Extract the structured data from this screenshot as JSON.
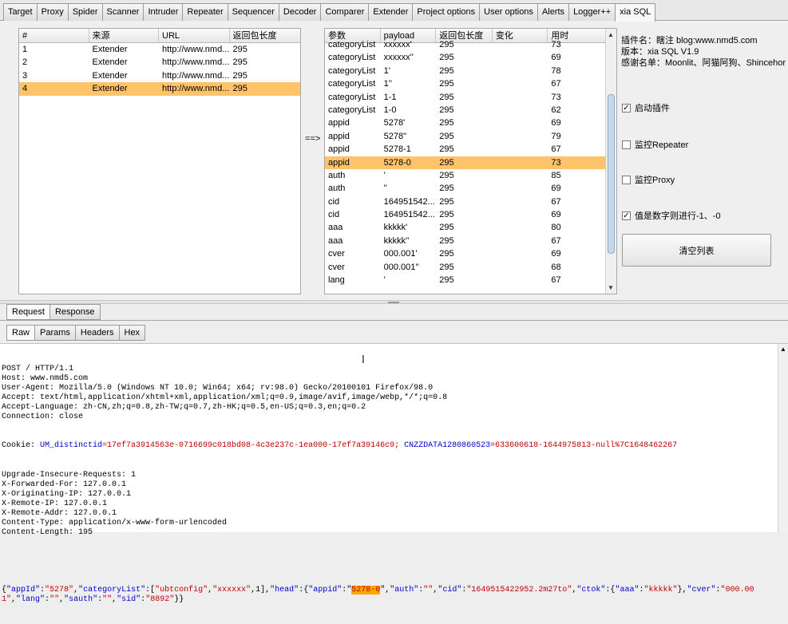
{
  "top_tabs": [
    "Target",
    "Proxy",
    "Spider",
    "Scanner",
    "Intruder",
    "Repeater",
    "Sequencer",
    "Decoder",
    "Comparer",
    "Extender",
    "Project options",
    "User options",
    "Alerts",
    "Logger++",
    "xia SQL"
  ],
  "active_tab": "xia SQL",
  "left_table": {
    "headers": [
      "#",
      "来源",
      "URL",
      "返回包长度"
    ],
    "rows": [
      [
        "1",
        "Extender",
        "http://www.nmd...",
        "295"
      ],
      [
        "2",
        "Extender",
        "http://www.nmd...",
        "295"
      ],
      [
        "3",
        "Extender",
        "http://www.nmd...",
        "295"
      ],
      [
        "4",
        "Extender",
        "http://www.nmd...",
        "295"
      ]
    ],
    "selected_index": 3
  },
  "arrow": "==>",
  "right_table": {
    "headers": [
      "参数",
      "payload",
      "返回包长度",
      "变化",
      "用时"
    ],
    "rows": [
      [
        "categoryList",
        "xxxxxx'",
        "295",
        "",
        "73"
      ],
      [
        "categoryList",
        "xxxxxx''",
        "295",
        "",
        "69"
      ],
      [
        "categoryList",
        "1'",
        "295",
        "",
        "78"
      ],
      [
        "categoryList",
        "1''",
        "295",
        "",
        "67"
      ],
      [
        "categoryList",
        "1-1",
        "295",
        "",
        "73"
      ],
      [
        "categoryList",
        "1-0",
        "295",
        "",
        "62"
      ],
      [
        "appid",
        "5278'",
        "295",
        "",
        "69"
      ],
      [
        "appid",
        "5278''",
        "295",
        "",
        "79"
      ],
      [
        "appid",
        "5278-1",
        "295",
        "",
        "67"
      ],
      [
        "appid",
        "5278-0",
        "295",
        "",
        "73"
      ],
      [
        "auth",
        "'",
        "295",
        "",
        "85"
      ],
      [
        "auth",
        "''",
        "295",
        "",
        "69"
      ],
      [
        "cid",
        "164951542...",
        "295",
        "",
        "67"
      ],
      [
        "cid",
        "164951542...",
        "295",
        "",
        "69"
      ],
      [
        "aaa",
        "kkkkk'",
        "295",
        "",
        "80"
      ],
      [
        "aaa",
        "kkkkk''",
        "295",
        "",
        "67"
      ],
      [
        "cver",
        "000.001'",
        "295",
        "",
        "69"
      ],
      [
        "cver",
        "000.001''",
        "295",
        "",
        "68"
      ],
      [
        "lang",
        "'",
        "295",
        "",
        "67"
      ]
    ],
    "selected_index": 9
  },
  "plugin_info": {
    "author": "插件名：瞎注 blog:www.nmd5.com",
    "version": "版本：xia SQL V1.9",
    "thanks": "感谢名单：Moonlit、阿猫阿狗、Shincehor"
  },
  "options": {
    "enable_plugin": {
      "label": "启动插件",
      "checked": true
    },
    "monitor_repeater": {
      "label": "监控Repeater",
      "checked": false
    },
    "monitor_proxy": {
      "label": "监控Proxy",
      "checked": false
    },
    "numeric_value": {
      "label": "值是数字则进行-1、-0",
      "checked": true
    },
    "clear_button": "清空列表"
  },
  "req_resp_tabs": [
    "Request",
    "Response"
  ],
  "view_tabs": [
    "Raw",
    "Params",
    "Headers",
    "Hex"
  ],
  "request": {
    "lines": [
      "POST / HTTP/1.1",
      "Host: www.nmd5.com",
      "User-Agent: Mozilla/5.0 (Windows NT 10.0; Win64; x64; rv:98.0) Gecko/20100101 Firefox/98.0",
      "Accept: text/html,application/xhtml+xml,application/xml;q=0.9,image/avif,image/webp,*/*;q=0.8",
      "Accept-Language: zh-CN,zh;q=0.8,zh-TW;q=0.7,zh-HK;q=0.5,en-US;q=0.3,en;q=0.2",
      "Connection: close"
    ],
    "cookie_label": "Cookie: ",
    "cookie_k1": "UM_distinctid",
    "cookie_v1": "=17ef7a3914563e-0716699c018bd08-4c3e237c-1ea000-17ef7a39146c9; ",
    "cookie_k2": "CNZZDATA1280860523",
    "cookie_v2": "=633600618-1644975813-null%7C1648462267",
    "lines2": [
      "Upgrade-Insecure-Requests: 1",
      "X-Forwarded-For: 127.0.0.1",
      "X-Originating-IP: 127.0.0.1",
      "X-Remote-IP: 127.0.0.1",
      "X-Remote-Addr: 127.0.0.1",
      "Content-Type: application/x-www-form-urlencoded",
      "Content-Length: 195"
    ],
    "body_a": "{",
    "body_k1": "\"appId\"",
    "body_s1": ":",
    "body_v1": "\"5278\"",
    "body_s2": ",",
    "body_k2": "\"categoryList\"",
    "body_s3": ":[",
    "body_v2": "\"ubtconfig\"",
    "body_s4": ",",
    "body_v3": "\"xxxxxx\"",
    "body_s5": ",1],",
    "body_k3": "\"head\"",
    "body_s6": ":{",
    "body_k4": "\"appid\"",
    "body_s7": ":\"",
    "body_hl": "5278-0",
    "body_s8": "\",",
    "body_k5": "\"auth\"",
    "body_s9": ":",
    "body_v4": "\"\"",
    "body_s10": ",",
    "body_k6": "\"cid\"",
    "body_s11": ":",
    "body_v5": "\"1649515422952.2m27to\"",
    "body_s12": ",",
    "body_k7": "\"ctok\"",
    "body_s13": ":{",
    "body_k8": "\"aaa\"",
    "body_s14": ":",
    "body_v6": "\"kkkkk\"",
    "body_s15": "},",
    "body_k9": "\"cver\"",
    "body_s16": ":",
    "body_v7": "\"000.001\"",
    "body_s17": ",",
    "body_k10": "\"lang\"",
    "body_s18": ":",
    "body_v8": "\"\"",
    "body_s19": ",",
    "body_k11": "\"sauth\"",
    "body_s20": ":",
    "body_v9": "\"\"",
    "body_s21": ",",
    "body_k12": "\"sid\"",
    "body_s22": ":",
    "body_v10": "\"8892\"",
    "body_s23": "}}"
  }
}
